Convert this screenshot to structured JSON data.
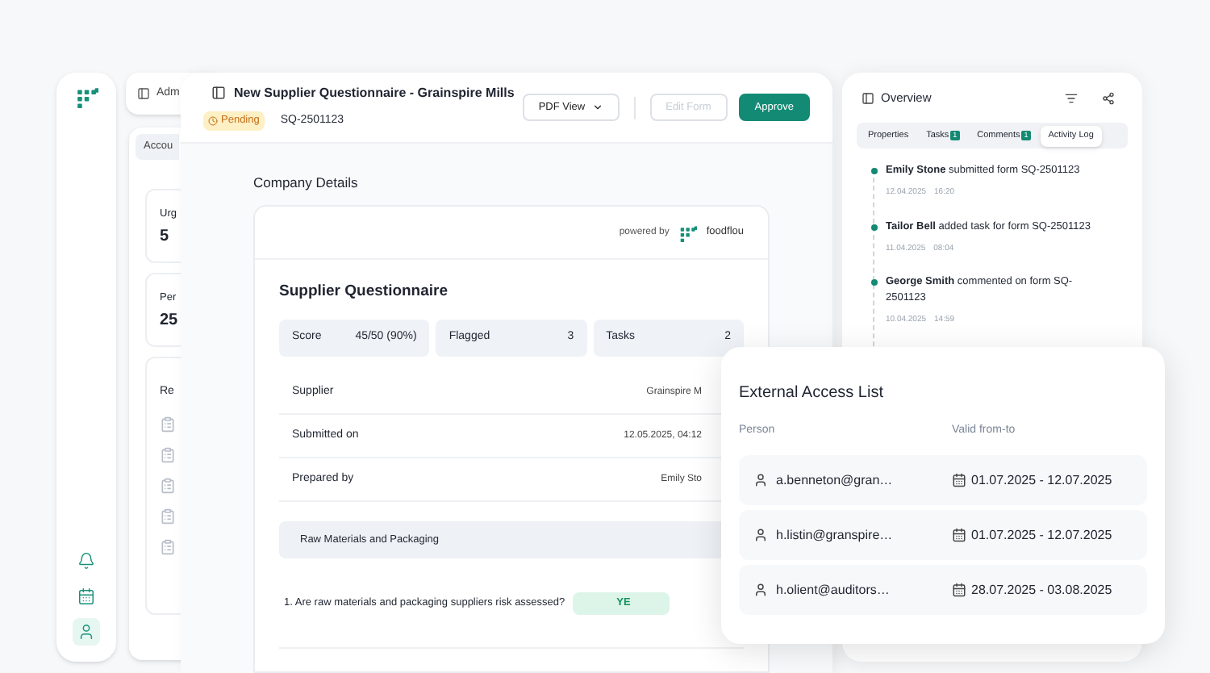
{
  "sidebar": {
    "items": [
      {
        "kind": "bell",
        "selected": false
      },
      {
        "kind": "calendar",
        "selected": false
      },
      {
        "kind": "user",
        "selected": true
      }
    ]
  },
  "background_app": {
    "header": "Adm",
    "tab": "Accou",
    "cards": [
      {
        "label": "Urg",
        "value": "5"
      },
      {
        "label": "Per",
        "value": "25"
      }
    ],
    "list_title": "Re"
  },
  "main_window": {
    "title": "New Supplier Questionnaire - Grainspire Mills",
    "status": "Pending",
    "reference": "SQ-2501123",
    "buttons": [
      {
        "label": "PDF View",
        "kind": "dropdown",
        "disabled": false
      },
      {
        "label": "Edit Form",
        "kind": "outline",
        "disabled": true
      },
      {
        "label": "Approve",
        "kind": "primary",
        "disabled": false
      }
    ],
    "section_title": "Company Details",
    "form": {
      "powered_by": "powered by",
      "brand": "foodflou",
      "title": "Supplier Questionnaire",
      "stats": [
        {
          "label": "Score",
          "value": "45/50 (90%)"
        },
        {
          "label": "Flagged",
          "value": "3"
        },
        {
          "label": "Tasks",
          "value": "2"
        }
      ],
      "fields": [
        {
          "label": "Supplier",
          "value": "Grainspire M"
        },
        {
          "label": "Submitted on",
          "value": "12.05.2025, 04:12"
        },
        {
          "label": "Prepared by",
          "value": "Emily Sto"
        }
      ],
      "group": "Raw Materials and Packaging",
      "questions": [
        {
          "text": "1. Are raw materials and packaging suppliers risk assessed?",
          "answer": "YE"
        }
      ]
    }
  },
  "overview": {
    "title": "Overview",
    "tabs": [
      {
        "label": "Properties",
        "selected": false
      },
      {
        "label": "Tasks",
        "badge": "1",
        "selected": false
      },
      {
        "label": "Comments",
        "badge": "1",
        "selected": false
      },
      {
        "label": "Activity Log",
        "selected": true
      }
    ],
    "activity": [
      {
        "text": "**Emily Stone** submitted form SQ-2501123",
        "date": "12.04.2025",
        "time": "16:20"
      },
      {
        "text": "**Tailor Bell** added task for form SQ-2501123",
        "date": "11.04.2025",
        "time": "08:04"
      },
      {
        "text": "**George Smith** commented on form SQ-2501123",
        "date": "10.04.2025",
        "time": "14:59"
      }
    ]
  },
  "external_access": {
    "title": "External Access List",
    "columns": [
      "Person",
      "Valid from-to"
    ],
    "rows": [
      {
        "person": "a.benneton@gran…",
        "valid": "01.07.2025 - 12.07.2025"
      },
      {
        "person": "h.listin@granspire…",
        "valid": "01.07.2025 - 12.07.2025"
      },
      {
        "person": "h.olient@auditors…",
        "valid": "28.07.2025 - 03.08.2025"
      }
    ]
  }
}
